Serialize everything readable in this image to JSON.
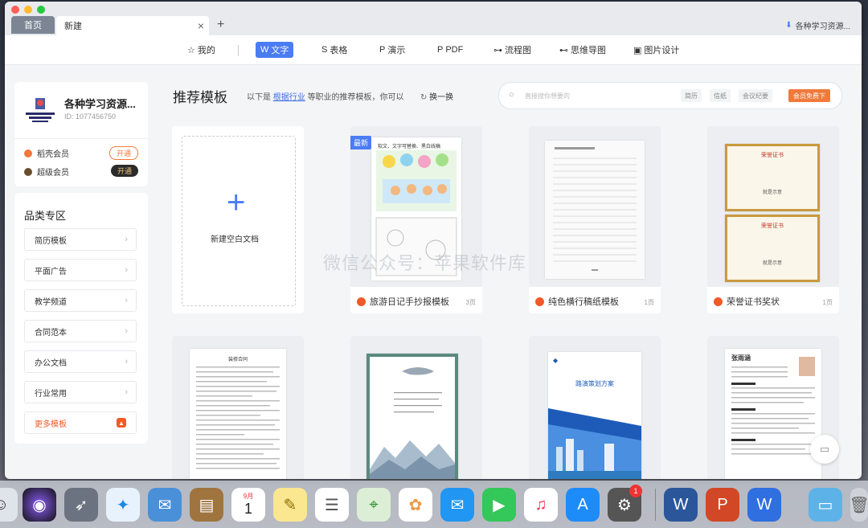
{
  "tabs": {
    "home": "首页",
    "new": "新建",
    "close": "×",
    "add": "+",
    "user": "各种学习资源..."
  },
  "toolbar": [
    {
      "icon": "☆",
      "label": "我的"
    },
    {
      "icon": "W",
      "label": "文字",
      "active": true
    },
    {
      "icon": "S",
      "label": "表格"
    },
    {
      "icon": "P",
      "label": "演示"
    },
    {
      "icon": "P",
      "label": "PDF"
    },
    {
      "icon": "⊶",
      "label": "流程图"
    },
    {
      "icon": "⊷",
      "label": "思维导图"
    },
    {
      "icon": "▣",
      "label": "图片设计"
    }
  ],
  "account": {
    "name": "各种学习资源...",
    "id": "ID: 1077456750",
    "logo_text": "LEARNING NEVER ENDS",
    "memberships": [
      {
        "label": "稻壳会员",
        "button": "开通",
        "color": "#f07a3c"
      },
      {
        "label": "超级会员",
        "button": "开通",
        "color": "#6b4e2e"
      }
    ]
  },
  "categories": {
    "title": "品类专区",
    "items": [
      "简历模板",
      "平面广告",
      "教学频道",
      "合同范本",
      "办公文档",
      "行业常用"
    ],
    "more": "更多模板"
  },
  "main": {
    "title": "推荐模板",
    "sub_prefix": "以下是",
    "sub_link": "根据行业",
    "sub_suffix": "等职业的推荐模板，你可以",
    "refresh": "换一换",
    "search_placeholder": "直接搜你想要的",
    "chips": [
      "简历",
      "信纸",
      "会议纪要"
    ],
    "vip": "会员免费下"
  },
  "templates": [
    {
      "label": "新建空白文档"
    },
    {
      "label": "旅游日记手抄报模板",
      "pages": "3页",
      "badge": "最新",
      "header": "软文、文字可替换、黑白线稿"
    },
    {
      "label": "纯色横行稿纸模板",
      "pages": "1页"
    },
    {
      "label": "荣誉证书奖状",
      "pages": "1页",
      "cert_title": "荣誉证书",
      "cert_sign": "就是示意"
    },
    {
      "label": "",
      "doc_title": "装修合同"
    },
    {
      "label": ""
    },
    {
      "label": "",
      "doc_title": "路演策划方案"
    },
    {
      "label": "",
      "doc_title": "张雨涵"
    }
  ],
  "watermark": "微信公众号：苹果软件库",
  "dock": {
    "calendar_month": "9月",
    "calendar_day": "1",
    "badge": "1"
  }
}
